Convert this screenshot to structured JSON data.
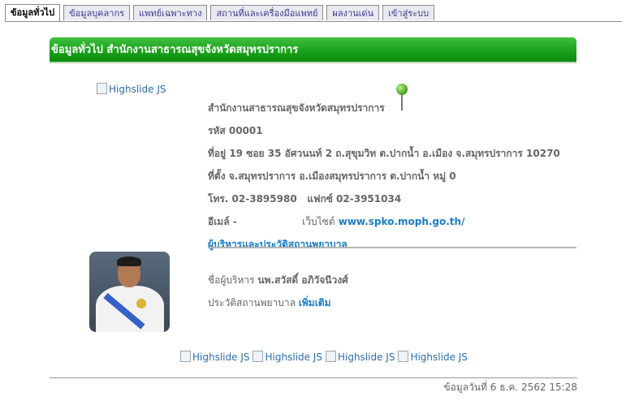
{
  "tabs": [
    {
      "label": "ข้อมูลทั่วไป",
      "active": true
    },
    {
      "label": "ข้อมูลบุคลากร",
      "active": false
    },
    {
      "label": "แพทย์เฉพาะทาง",
      "active": false
    },
    {
      "label": "สถานที่และเครื่องมือแพทย์",
      "active": false
    },
    {
      "label": "ผลงานเด่น",
      "active": false
    },
    {
      "label": "เข้าสู่ระบบ",
      "active": false
    }
  ],
  "header": {
    "title": "ข้อมูลทั่วไป สำนักงานสาธารณสุขจังหวัดสมุทรปราการ"
  },
  "main_image_alt": "Highslide JS",
  "info": {
    "org_name": "สำนักงานสาธารณสุขจังหวัดสมุทรปราการ",
    "code": "รหัส 00001",
    "address": "ที่อยู่ 19 ซอย 35 อัศวนนท์ 2 ถ.สุขุมวิท ต.ปากน้ำ อ.เมือง จ.สมุทรปราการ 10270",
    "location": "ที่ตั้ง จ.สมุทรปราการ อ.เมืองสมุทรปราการ ต.ปากน้ำ หมู่ 0",
    "phone": "โทร. 02-3895980",
    "fax": "แฟกซ์ 02-3951034",
    "email_label": "อีเมล์ -",
    "website_label": "เว็บไซต์",
    "website_url": "www.spko.moph.go.th/"
  },
  "admin_section": {
    "title": "ผู้บริหารและประวัติสถานพยาบาล",
    "director_label": "ชื่อผู้บริหาร",
    "director_name": "นพ.สวัสดิ์ อภิวัจนีวงศ์",
    "history_label": "ประวัติสถานพยาบาล",
    "more_link": "เพิ่มเติม"
  },
  "gallery": [
    "Highslide JS",
    "Highslide JS",
    "Highslide JS",
    "Highslide JS"
  ],
  "footer": {
    "updated": "ข้อมูลวันที่ 6 ธ.ค. 2562 15:28"
  },
  "colors": {
    "header_green": "#1aa21a",
    "link_blue": "#1a7cc6"
  }
}
